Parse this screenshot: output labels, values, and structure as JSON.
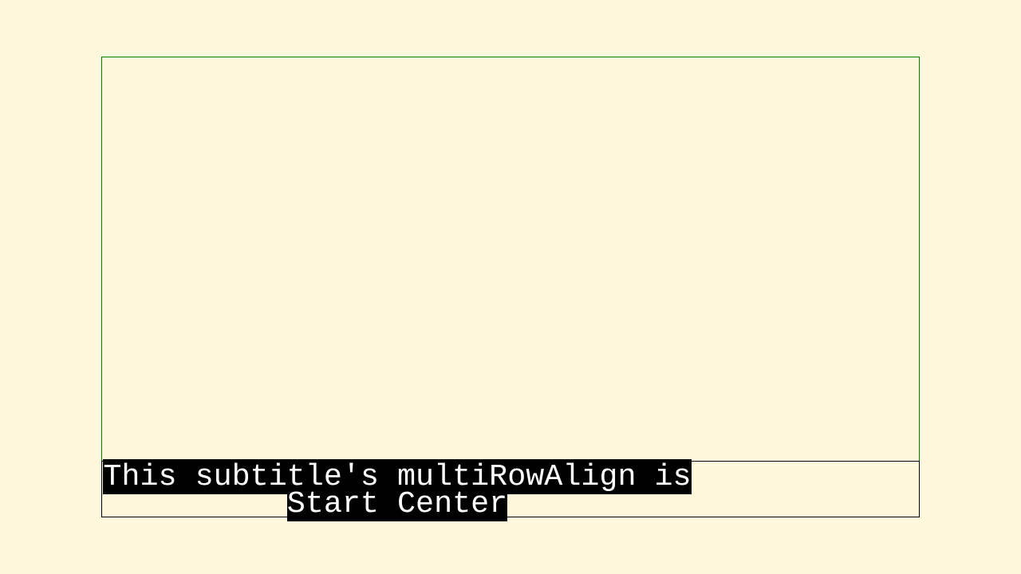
{
  "subtitle": {
    "lines": [
      "This subtitle's multiRowAlign is",
      "Start Center"
    ]
  },
  "colors": {
    "page_background": "#fff8dc",
    "video_region_border": "#008000",
    "subtitle_region_border": "#000000",
    "cue_background": "#000000",
    "cue_text": "#ffffff"
  }
}
